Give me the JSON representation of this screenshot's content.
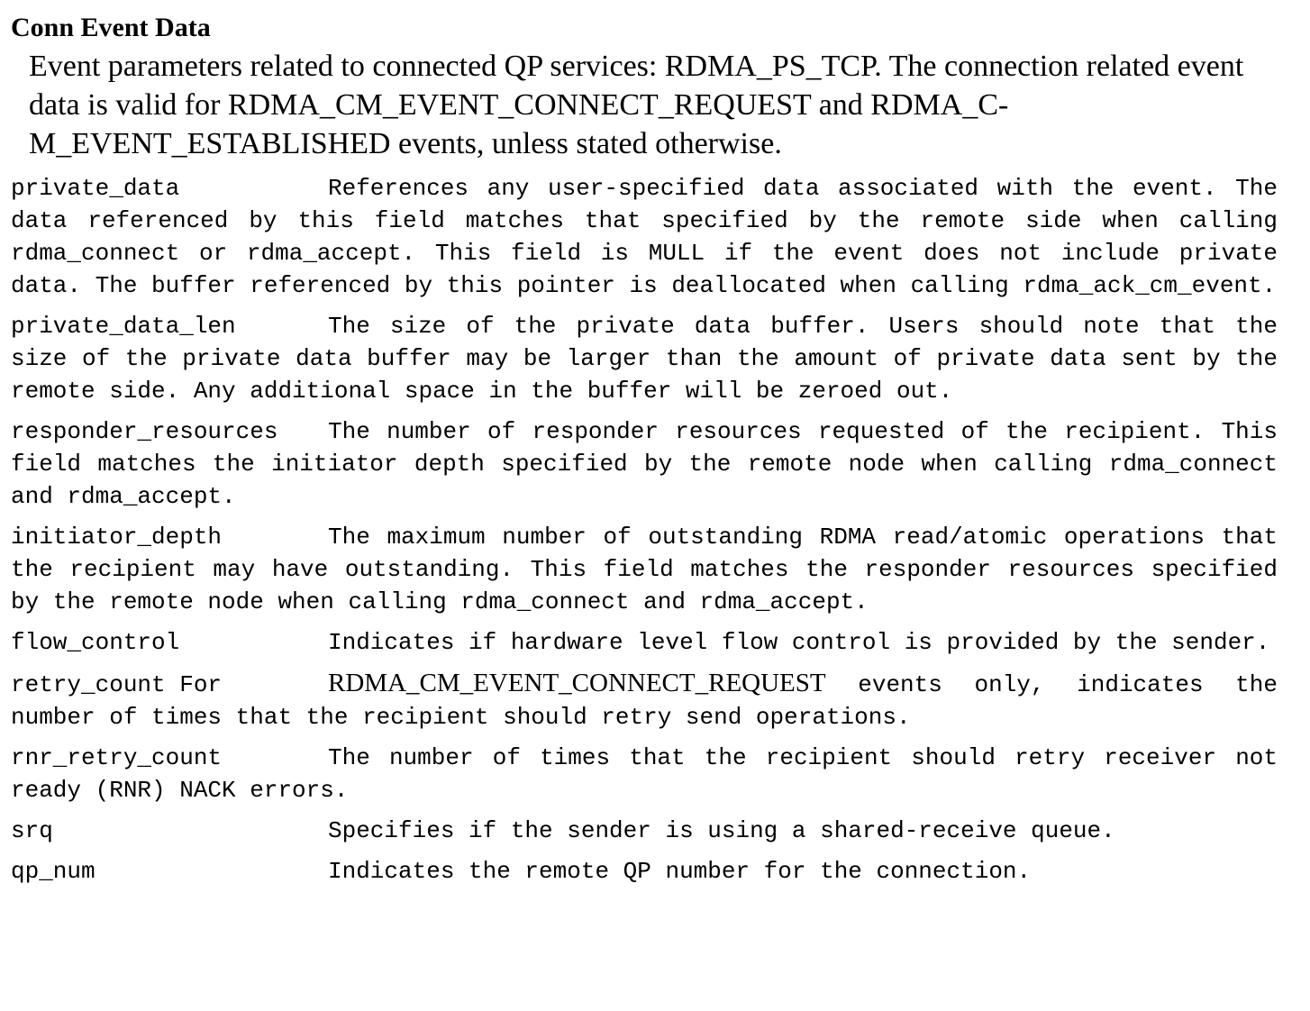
{
  "section": {
    "title": "Conn Event Data",
    "intro": "Event parameters related to connected QP services: RDMA_PS_TCP. The connection related event data is   valid   for RDMA_CM_EVENT_CONNECT_REQUEST and RDMA_C-M_EVENT_ESTABLISHED events, unless stated otherwise."
  },
  "entries": [
    {
      "term": "private_data",
      "desc": "References any user-specified data associated with the event. The data referenced by this field matches that specified by the remote side when calling rdma_connect or rdma_accept. This field is MULL if the event does not include private data. The buffer referenced by this pointer is deallocated when calling rdma_ack_cm_event."
    },
    {
      "term": "private_data_len",
      "desc": "The size of the private data buffer. Users should note that the size of the private data buffer may be larger than the amount of private data sent by the remote side. Any additional space in the buffer will be zeroed out."
    },
    {
      "term": "responder_resources",
      "desc": "The number of responder resources requested of the recipient. This field matches the initiator depth specified by the remote node when calling rdma_connect and rdma_accept."
    },
    {
      "term": "initiator_depth",
      "desc": "The maximum number of outstanding RDMA read/atomic operations that the recipient may have outstanding. This field matches the responder resources specified by the remote node when calling rdma_connect and rdma_accept."
    },
    {
      "term": "flow_control",
      "desc": "Indicates if hardware level flow control is provided by the sender."
    },
    {
      "term": "retry_count For",
      "desc_serif": "RDMA_CM_EVENT_CONNECT_REQUEST",
      "desc": " events only, indicates the number of times that the recipient should retry send operations."
    },
    {
      "term": "rnr_retry_count",
      "desc": "The number of times that the recipient should retry receiver not ready (RNR) NACK errors."
    },
    {
      "term": "srq",
      "desc": "Specifies if the sender is using a shared-receive queue."
    },
    {
      "term": "qp_num",
      "desc": "Indicates the remote QP number for the connection."
    }
  ]
}
